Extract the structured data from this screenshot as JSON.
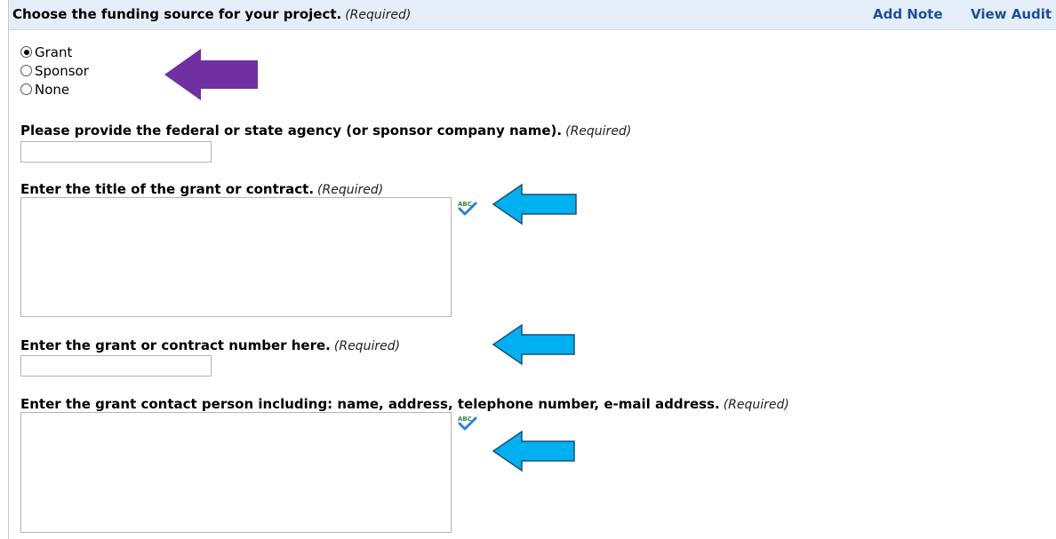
{
  "header": {
    "question": "Choose the funding source for your project.",
    "required": "(Required)",
    "add_note": "Add Note",
    "view_audit": "View Audit"
  },
  "funding_options": [
    {
      "label": "Grant",
      "checked": true
    },
    {
      "label": "Sponsor",
      "checked": false
    },
    {
      "label": "None",
      "checked": false
    }
  ],
  "questions": {
    "agency": {
      "label": "Please provide the federal or state agency (or sponsor company name).",
      "required": "(Required)",
      "value": ""
    },
    "title": {
      "label": "Enter the title of the grant or contract.",
      "required": "(Required)",
      "value": ""
    },
    "number": {
      "label": "Enter the grant or contract number here.",
      "required": "(Required)",
      "value": ""
    },
    "contact": {
      "label": "Enter the grant contact person including: name, address, telephone number, e-mail address.",
      "required": "(Required)",
      "value": ""
    }
  },
  "spellcheck": {
    "icon_text": "ABC",
    "icon": "spellcheck-icon"
  },
  "annotations": {
    "purple_arrow_color": "#7030a0",
    "blue_arrow_color": "#00b0f0"
  }
}
